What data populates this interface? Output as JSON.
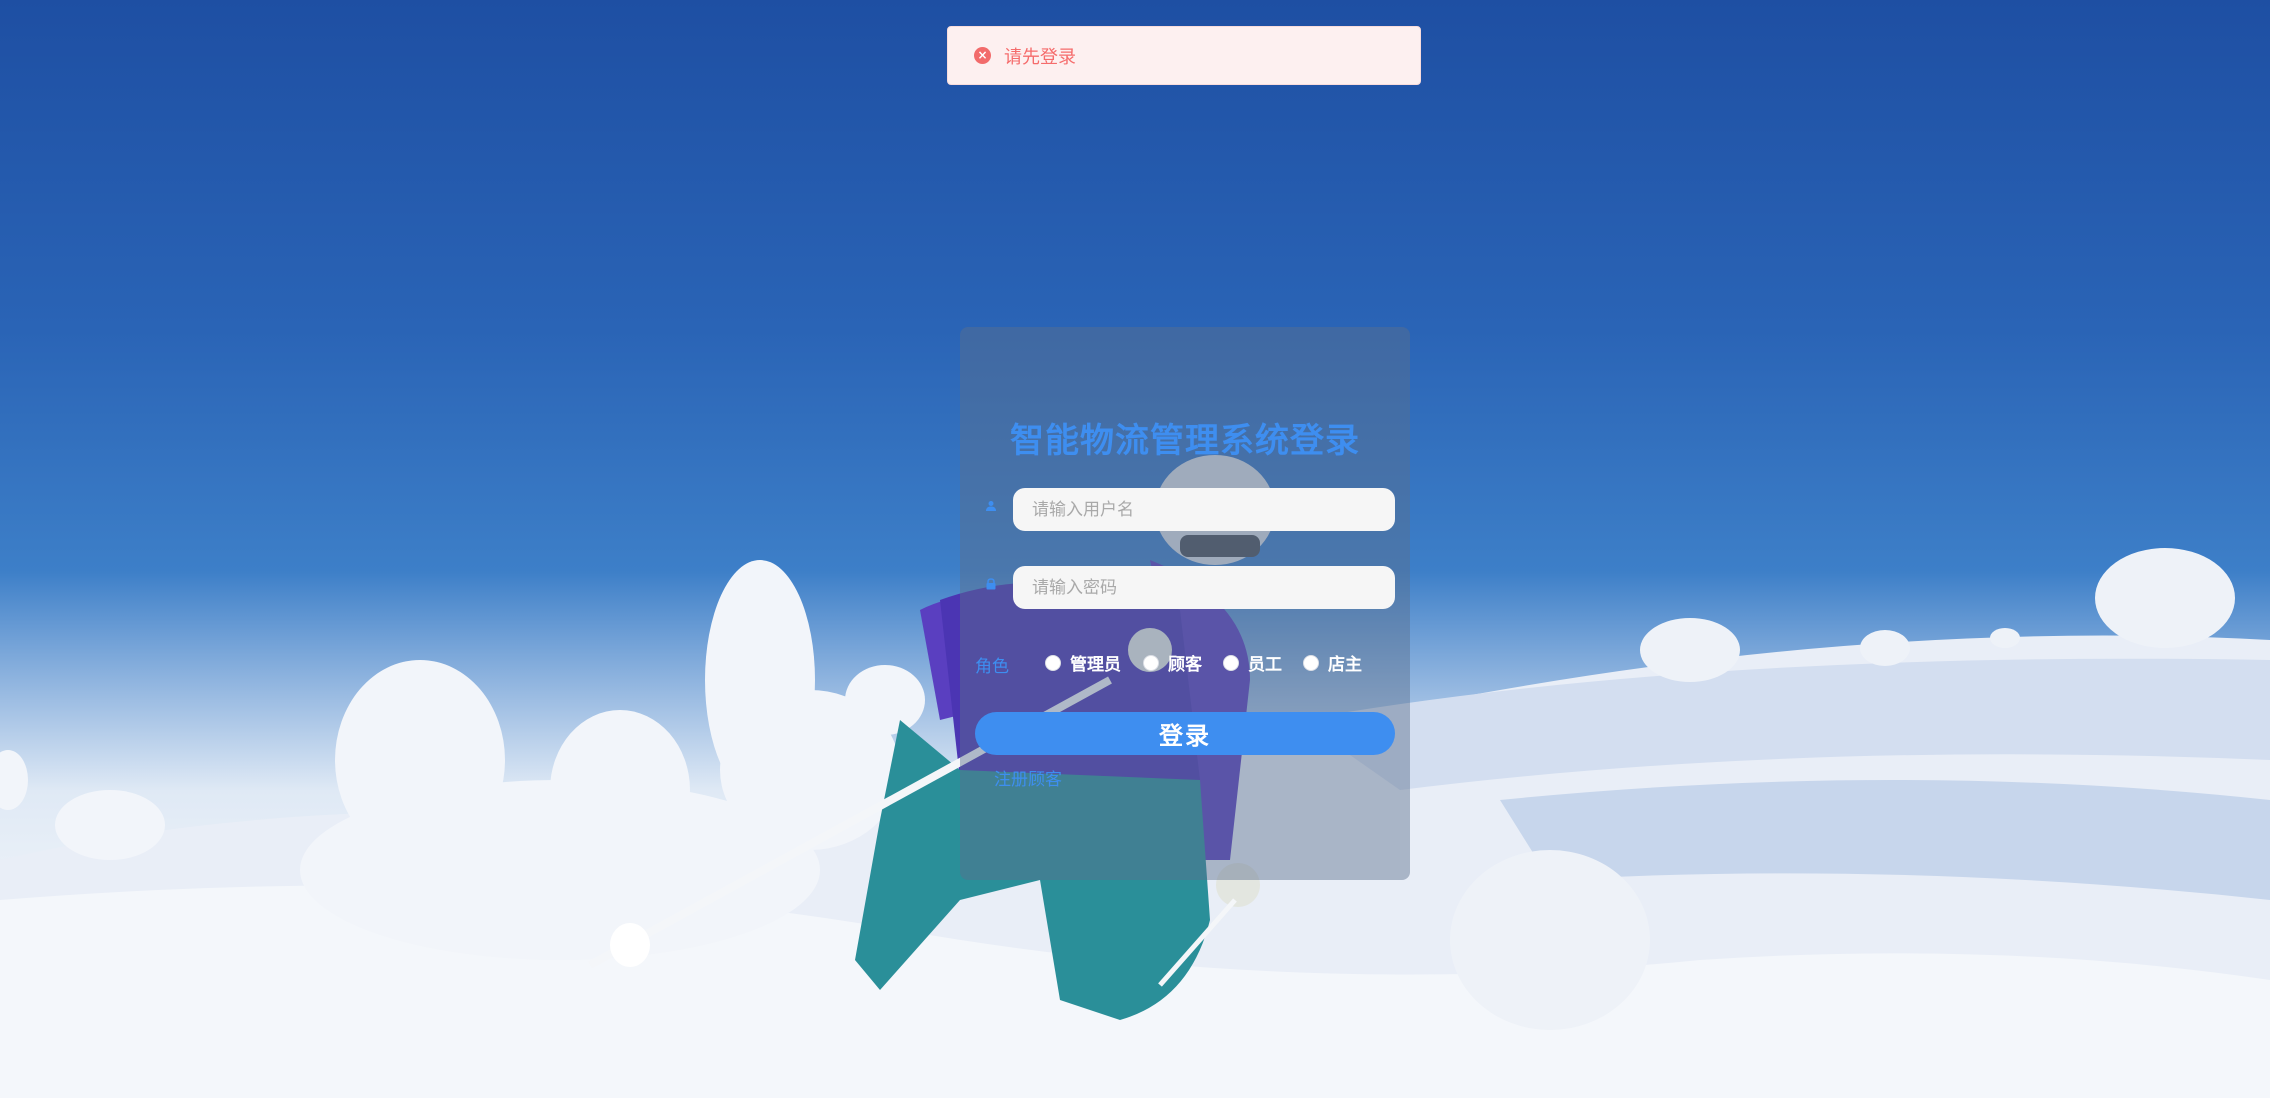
{
  "toast": {
    "icon": "error-circle-icon",
    "message": "请先登录",
    "color": "#f56c6c"
  },
  "login": {
    "title": "智能物流管理系统登录",
    "username": {
      "icon": "user-icon",
      "placeholder": "请输入用户名",
      "value": ""
    },
    "password": {
      "icon": "lock-icon",
      "placeholder": "请输入密码",
      "value": ""
    },
    "role": {
      "label": "角色",
      "options": [
        "管理员",
        "顾客",
        "员工",
        "店主"
      ]
    },
    "submit_label": "登录",
    "register_label": "注册顾客",
    "accent_color": "#3e8ef0"
  }
}
